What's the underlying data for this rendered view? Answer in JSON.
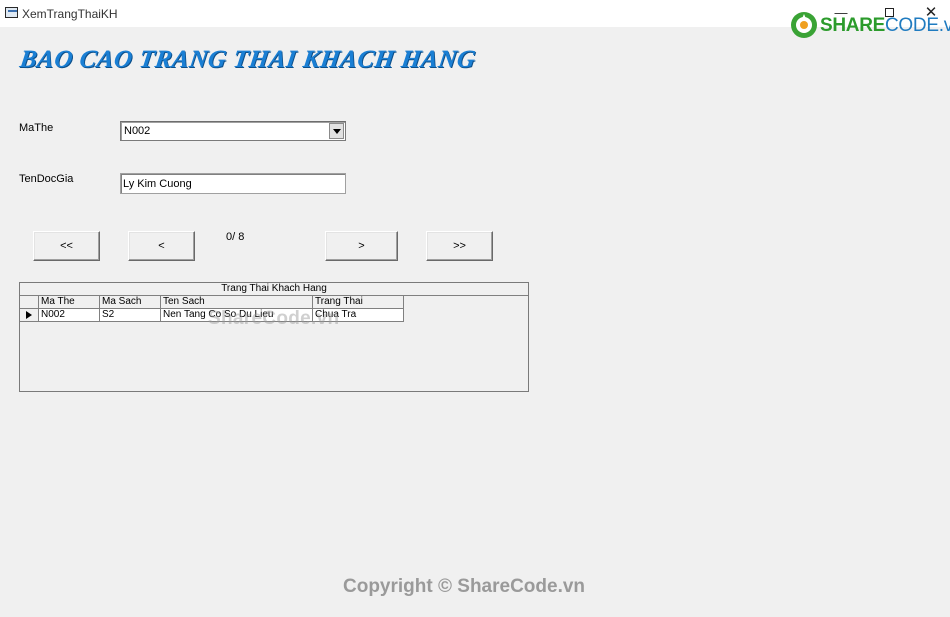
{
  "window": {
    "title": "XemTrangThaiKH",
    "controls": {
      "minimize": "—",
      "maximize": "☐",
      "close": "✕"
    }
  },
  "watermark": {
    "logo_brand": "SHARE",
    "logo_rest": "CODE.vn",
    "center": "ShareCode.vn",
    "footer": "Copyright © ShareCode.vn"
  },
  "heading": "BAO CAO TRANG THAI KHACH HANG",
  "form": {
    "mathe_label": "MaThe",
    "mathe_value": "N002",
    "tendocgia_label": "TenDocGia",
    "tendocgia_value": "Ly Kim Cuong"
  },
  "nav": {
    "first": "<<",
    "prev": "<",
    "counter": "0/ 8",
    "next": ">",
    "last": ">>"
  },
  "grid": {
    "caption": "Trang Thai Khach Hang",
    "columns": [
      "Ma The",
      "Ma Sach",
      "Ten Sach",
      "Trang Thai"
    ],
    "rows": [
      [
        "N002",
        "S2",
        "Nen Tang Co So Du Lieu",
        "Chua Tra"
      ]
    ]
  },
  "colors": {
    "heading": "#1a7fd4",
    "background": "#f0f0f0"
  }
}
